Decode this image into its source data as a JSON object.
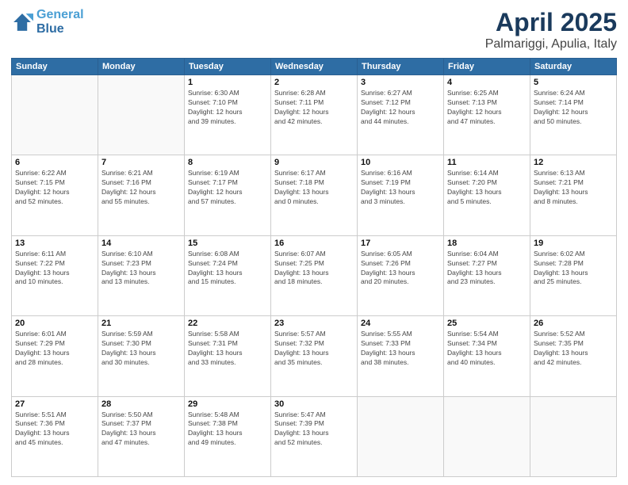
{
  "header": {
    "logo_line1": "General",
    "logo_line2": "Blue",
    "month": "April 2025",
    "location": "Palmariggi, Apulia, Italy"
  },
  "weekdays": [
    "Sunday",
    "Monday",
    "Tuesday",
    "Wednesday",
    "Thursday",
    "Friday",
    "Saturday"
  ],
  "weeks": [
    [
      {
        "day": "",
        "info": ""
      },
      {
        "day": "",
        "info": ""
      },
      {
        "day": "1",
        "info": "Sunrise: 6:30 AM\nSunset: 7:10 PM\nDaylight: 12 hours\nand 39 minutes."
      },
      {
        "day": "2",
        "info": "Sunrise: 6:28 AM\nSunset: 7:11 PM\nDaylight: 12 hours\nand 42 minutes."
      },
      {
        "day": "3",
        "info": "Sunrise: 6:27 AM\nSunset: 7:12 PM\nDaylight: 12 hours\nand 44 minutes."
      },
      {
        "day": "4",
        "info": "Sunrise: 6:25 AM\nSunset: 7:13 PM\nDaylight: 12 hours\nand 47 minutes."
      },
      {
        "day": "5",
        "info": "Sunrise: 6:24 AM\nSunset: 7:14 PM\nDaylight: 12 hours\nand 50 minutes."
      }
    ],
    [
      {
        "day": "6",
        "info": "Sunrise: 6:22 AM\nSunset: 7:15 PM\nDaylight: 12 hours\nand 52 minutes."
      },
      {
        "day": "7",
        "info": "Sunrise: 6:21 AM\nSunset: 7:16 PM\nDaylight: 12 hours\nand 55 minutes."
      },
      {
        "day": "8",
        "info": "Sunrise: 6:19 AM\nSunset: 7:17 PM\nDaylight: 12 hours\nand 57 minutes."
      },
      {
        "day": "9",
        "info": "Sunrise: 6:17 AM\nSunset: 7:18 PM\nDaylight: 13 hours\nand 0 minutes."
      },
      {
        "day": "10",
        "info": "Sunrise: 6:16 AM\nSunset: 7:19 PM\nDaylight: 13 hours\nand 3 minutes."
      },
      {
        "day": "11",
        "info": "Sunrise: 6:14 AM\nSunset: 7:20 PM\nDaylight: 13 hours\nand 5 minutes."
      },
      {
        "day": "12",
        "info": "Sunrise: 6:13 AM\nSunset: 7:21 PM\nDaylight: 13 hours\nand 8 minutes."
      }
    ],
    [
      {
        "day": "13",
        "info": "Sunrise: 6:11 AM\nSunset: 7:22 PM\nDaylight: 13 hours\nand 10 minutes."
      },
      {
        "day": "14",
        "info": "Sunrise: 6:10 AM\nSunset: 7:23 PM\nDaylight: 13 hours\nand 13 minutes."
      },
      {
        "day": "15",
        "info": "Sunrise: 6:08 AM\nSunset: 7:24 PM\nDaylight: 13 hours\nand 15 minutes."
      },
      {
        "day": "16",
        "info": "Sunrise: 6:07 AM\nSunset: 7:25 PM\nDaylight: 13 hours\nand 18 minutes."
      },
      {
        "day": "17",
        "info": "Sunrise: 6:05 AM\nSunset: 7:26 PM\nDaylight: 13 hours\nand 20 minutes."
      },
      {
        "day": "18",
        "info": "Sunrise: 6:04 AM\nSunset: 7:27 PM\nDaylight: 13 hours\nand 23 minutes."
      },
      {
        "day": "19",
        "info": "Sunrise: 6:02 AM\nSunset: 7:28 PM\nDaylight: 13 hours\nand 25 minutes."
      }
    ],
    [
      {
        "day": "20",
        "info": "Sunrise: 6:01 AM\nSunset: 7:29 PM\nDaylight: 13 hours\nand 28 minutes."
      },
      {
        "day": "21",
        "info": "Sunrise: 5:59 AM\nSunset: 7:30 PM\nDaylight: 13 hours\nand 30 minutes."
      },
      {
        "day": "22",
        "info": "Sunrise: 5:58 AM\nSunset: 7:31 PM\nDaylight: 13 hours\nand 33 minutes."
      },
      {
        "day": "23",
        "info": "Sunrise: 5:57 AM\nSunset: 7:32 PM\nDaylight: 13 hours\nand 35 minutes."
      },
      {
        "day": "24",
        "info": "Sunrise: 5:55 AM\nSunset: 7:33 PM\nDaylight: 13 hours\nand 38 minutes."
      },
      {
        "day": "25",
        "info": "Sunrise: 5:54 AM\nSunset: 7:34 PM\nDaylight: 13 hours\nand 40 minutes."
      },
      {
        "day": "26",
        "info": "Sunrise: 5:52 AM\nSunset: 7:35 PM\nDaylight: 13 hours\nand 42 minutes."
      }
    ],
    [
      {
        "day": "27",
        "info": "Sunrise: 5:51 AM\nSunset: 7:36 PM\nDaylight: 13 hours\nand 45 minutes."
      },
      {
        "day": "28",
        "info": "Sunrise: 5:50 AM\nSunset: 7:37 PM\nDaylight: 13 hours\nand 47 minutes."
      },
      {
        "day": "29",
        "info": "Sunrise: 5:48 AM\nSunset: 7:38 PM\nDaylight: 13 hours\nand 49 minutes."
      },
      {
        "day": "30",
        "info": "Sunrise: 5:47 AM\nSunset: 7:39 PM\nDaylight: 13 hours\nand 52 minutes."
      },
      {
        "day": "",
        "info": ""
      },
      {
        "day": "",
        "info": ""
      },
      {
        "day": "",
        "info": ""
      }
    ]
  ]
}
